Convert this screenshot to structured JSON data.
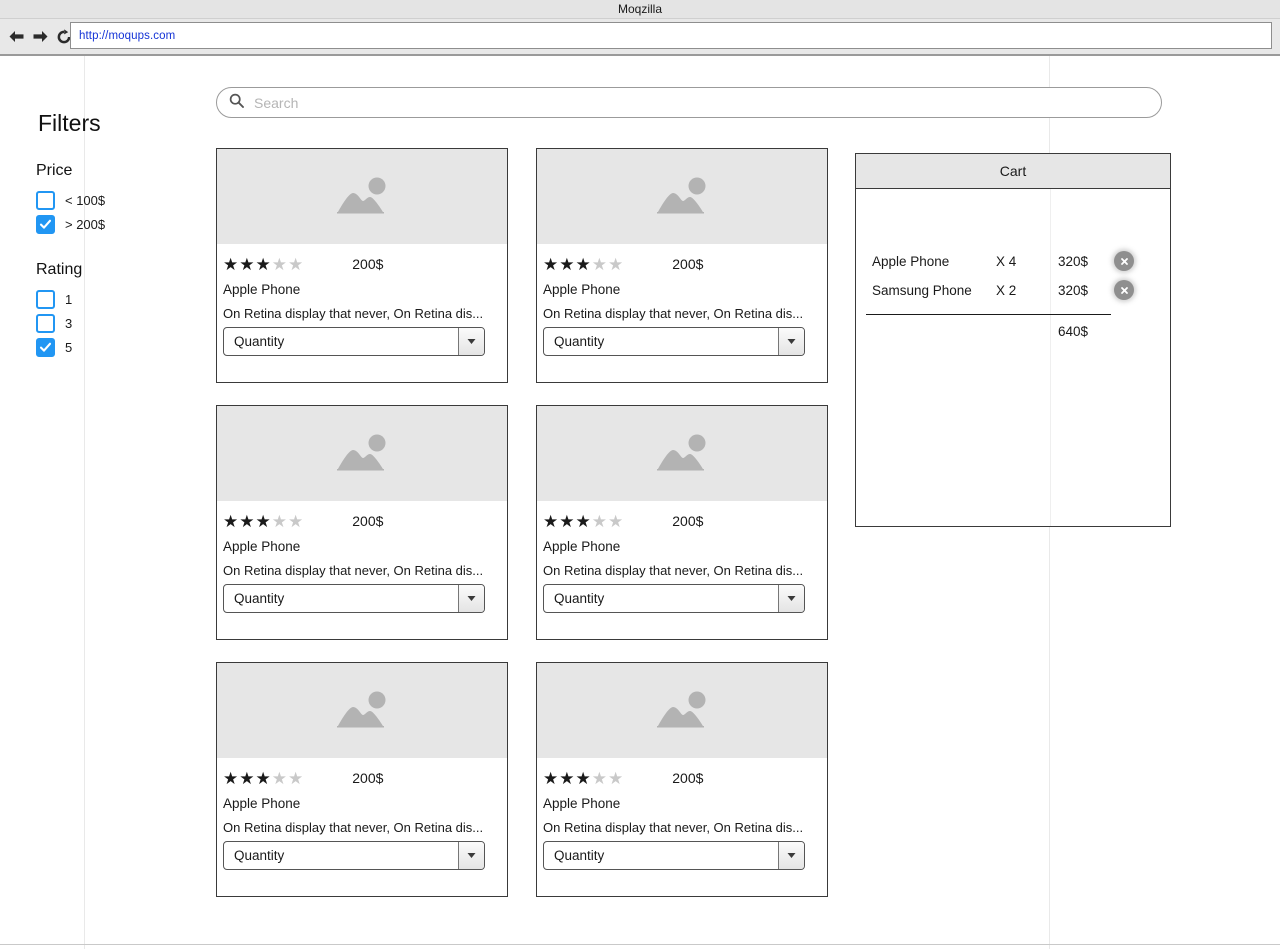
{
  "browser": {
    "window_title": "Moqzilla",
    "url": "http://moqups.com",
    "back_icon": "arrow-left-icon",
    "forward_icon": "arrow-right-icon",
    "reload_icon": "reload-icon"
  },
  "search": {
    "placeholder": "Search",
    "value": "",
    "icon": "search-icon"
  },
  "sidebar": {
    "title": "Filters",
    "groups": [
      {
        "title": "Price",
        "options": [
          {
            "label": "< 100$",
            "checked": false
          },
          {
            "label": "> 200$",
            "checked": true
          }
        ]
      },
      {
        "title": "Rating",
        "options": [
          {
            "label": "1",
            "checked": false
          },
          {
            "label": "3",
            "checked": false
          },
          {
            "label": "5",
            "checked": true
          }
        ]
      }
    ],
    "accent_color": "#2196f3"
  },
  "products": [
    {
      "rating": 3,
      "max_rating": 5,
      "price": "200$",
      "title": "Apple Phone",
      "description": "On Retina display that never, On Retina dis...",
      "quantity_label": "Quantity",
      "image_icon": "image-placeholder-icon"
    },
    {
      "rating": 3,
      "max_rating": 5,
      "price": "200$",
      "title": "Apple Phone",
      "description": "On Retina display that never, On Retina dis...",
      "quantity_label": "Quantity",
      "image_icon": "image-placeholder-icon"
    },
    {
      "rating": 3,
      "max_rating": 5,
      "price": "200$",
      "title": "Apple Phone",
      "description": "On Retina display that never, On Retina dis...",
      "quantity_label": "Quantity",
      "image_icon": "image-placeholder-icon"
    },
    {
      "rating": 3,
      "max_rating": 5,
      "price": "200$",
      "title": "Apple Phone",
      "description": "On Retina display that never, On Retina dis...",
      "quantity_label": "Quantity",
      "image_icon": "image-placeholder-icon"
    },
    {
      "rating": 3,
      "max_rating": 5,
      "price": "200$",
      "title": "Apple Phone",
      "description": "On Retina display that never, On Retina dis...",
      "quantity_label": "Quantity",
      "image_icon": "image-placeholder-icon"
    },
    {
      "rating": 3,
      "max_rating": 5,
      "price": "200$",
      "title": "Apple Phone",
      "description": "On Retina display that never, On Retina dis...",
      "quantity_label": "Quantity",
      "image_icon": "image-placeholder-icon"
    }
  ],
  "cart": {
    "title": "Cart",
    "items": [
      {
        "name": "Apple Phone",
        "quantity": "X 4",
        "amount": "320$",
        "remove_icon": "close-circle-icon"
      },
      {
        "name": "Samsung Phone",
        "quantity": "X 2",
        "amount": "320$",
        "remove_icon": "close-circle-icon"
      }
    ],
    "total": "640$"
  }
}
